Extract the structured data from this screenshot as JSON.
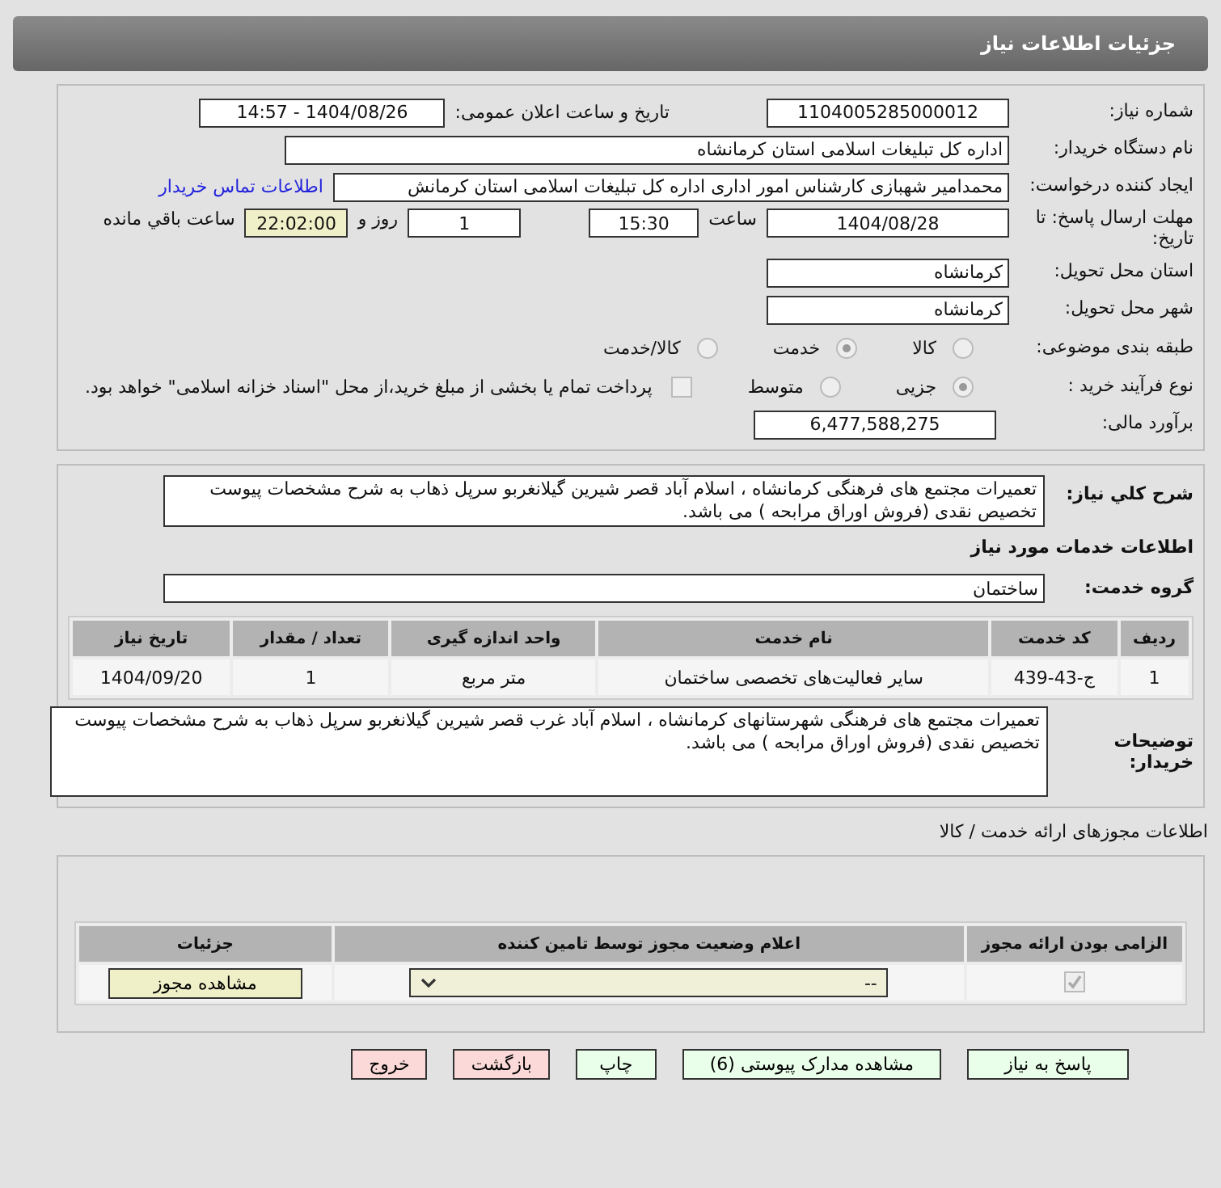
{
  "header": {
    "title": "جزئیات اطلاعات نیاز"
  },
  "need_number": {
    "label": "شماره نیاز:",
    "value": "1104005285000012"
  },
  "announce": {
    "label": "تاریخ و ساعت اعلان عمومی:",
    "value": "1404/08/26 - 14:57"
  },
  "buyer_org": {
    "label": "نام دستگاه خریدار:",
    "value": "اداره کل تبلیغات اسلامی استان کرمانشاه"
  },
  "requester": {
    "label": "ایجاد کننده درخواست:",
    "value": "محمدامیر شهبازی کارشناس امور اداری اداره کل تبلیغات اسلامی استان کرمانش",
    "link": "اطلاعات تماس خریدار"
  },
  "deadline": {
    "label": "مهلت ارسال پاسخ: تا تاریخ:",
    "date": "1404/08/28",
    "time_label": "ساعت",
    "time": "15:30",
    "days": "1",
    "days_label": "روز و",
    "remaining": "22:02:00",
    "remaining_label": "ساعت باقي مانده"
  },
  "province": {
    "label": "استان محل تحویل:",
    "value": "کرمانشاه"
  },
  "city": {
    "label": "شهر محل تحویل:",
    "value": "کرمانشاه"
  },
  "category": {
    "label": "طبقه بندی موضوعی:",
    "options": [
      {
        "label": "کالا",
        "selected": false
      },
      {
        "label": "خدمت",
        "selected": true
      },
      {
        "label": "کالا/خدمت",
        "selected": false
      }
    ]
  },
  "purchase_type": {
    "label": "نوع فرآیند خرید :",
    "options": [
      {
        "label": "جزیی",
        "selected": true
      },
      {
        "label": "متوسط",
        "selected": false
      }
    ],
    "treasury": {
      "checked": false,
      "text": "پرداخت تمام یا بخشی از مبلغ خرید،از محل \"اسناد خزانه اسلامی\" خواهد بود."
    }
  },
  "budget": {
    "label": "برآورد مالی:",
    "value": "6,477,588,275"
  },
  "summary": {
    "label": "شرح کلي نیاز:",
    "value": "تعمیرات مجتمع های فرهنگی  کرمانشاه ، اسلام آباد  قصر شیرین گیلانغربو سرپل ذهاب به شرح مشخصات پیوست تخصیص نقدی (فروش اوراق مرابحه ) می باشد."
  },
  "services_title": "اطلاعات خدمات مورد نیاز",
  "service_group": {
    "label": "گروه خدمت:",
    "value": "ساختمان"
  },
  "table": {
    "columns": [
      "ردیف",
      "کد خدمت",
      "نام خدمت",
      "واحد اندازه گیری",
      "تعداد / مقدار",
      "تاریخ نیاز"
    ],
    "rows": [
      [
        "1",
        "ج-43-439",
        "سایر فعالیت‌های تخصصی ساختمان",
        "متر مربع",
        "1",
        "1404/09/20"
      ]
    ]
  },
  "buyer_notes": {
    "label": "توضیحات خریدار:",
    "value": "تعمیرات مجتمع های فرهنگی شهرستانهای کرمانشاه ، اسلام آباد غرب قصر شیرین گیلانغربو سرپل ذهاب به شرح مشخصات پیوست تخصیص نقدی (فروش اوراق مرابحه ) می باشد."
  },
  "permits": {
    "title": "اطلاعات مجوزهای ارائه خدمت / کالا",
    "columns": [
      "الزامی بودن ارائه مجوز",
      "اعلام وضعیت مجوز توسط تامین کننده",
      "جزئیات"
    ],
    "rows": [
      {
        "required": true,
        "status": "--",
        "button": "مشاهده مجوز"
      }
    ]
  },
  "buttons": [
    {
      "label": "پاسخ به نیاز",
      "kind": "action"
    },
    {
      "label": "مشاهده مدارک پیوستی (6)",
      "kind": "action"
    },
    {
      "label": "چاپ",
      "kind": "action"
    },
    {
      "label": "بازگشت",
      "kind": "exit"
    },
    {
      "label": "خروج",
      "kind": "exit"
    }
  ]
}
